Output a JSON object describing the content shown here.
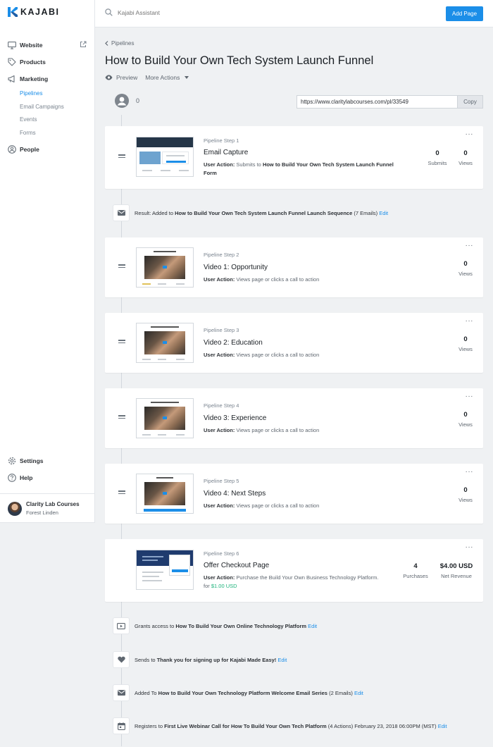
{
  "app": {
    "brand": "KAJABI",
    "accent": "#1b8ee8",
    "success": "#1cb37b"
  },
  "sidebar": {
    "items": [
      {
        "label": "Website",
        "icon": "monitor-icon"
      },
      {
        "label": "Products",
        "icon": "tag-icon"
      },
      {
        "label": "Marketing",
        "icon": "megaphone-icon"
      }
    ],
    "marketing_sub": [
      "Pipelines",
      "Email Campaigns",
      "Events",
      "Forms"
    ],
    "people": "People",
    "settings": "Settings",
    "help": "Help",
    "user": {
      "name": "Clarity Lab Courses",
      "sub": "Forest Linden"
    }
  },
  "topbar": {
    "search_placeholder": "Kajabi Assistant",
    "add_page": "Add Page"
  },
  "page": {
    "breadcrumb": "Pipelines",
    "title": "How to Build Your Own Tech System Launch Funnel",
    "preview": "Preview",
    "more_actions": "More Actions",
    "lead_count": "0",
    "url": "https://www.claritylabcourses.com/pl/33549",
    "copy": "Copy"
  },
  "steps": [
    {
      "label": "Pipeline Step 1",
      "title": "Email Capture",
      "action_label": "User Action:",
      "action_text": "Submits to",
      "action_bold": "How to Build Your Own Tech System Launch Funnel Form",
      "stats": [
        {
          "value": "0",
          "label": "Submits"
        },
        {
          "value": "0",
          "label": "Views"
        }
      ]
    },
    {
      "label": "Pipeline Step 2",
      "title": "Video 1: Opportunity",
      "action_label": "User Action:",
      "action_text": "Views page or clicks a call to action",
      "stats": [
        {
          "value": "0",
          "label": "Views"
        }
      ]
    },
    {
      "label": "Pipeline Step 3",
      "title": "Video 2: Education",
      "action_label": "User Action:",
      "action_text": "Views page or clicks a call to action",
      "stats": [
        {
          "value": "0",
          "label": "Views"
        }
      ]
    },
    {
      "label": "Pipeline Step 4",
      "title": "Video 3: Experience",
      "action_label": "User Action:",
      "action_text": "Views page or clicks a call to action",
      "stats": [
        {
          "value": "0",
          "label": "Views"
        }
      ]
    },
    {
      "label": "Pipeline Step 5",
      "title": "Video 4: Next Steps",
      "action_label": "User Action:",
      "action_text": "Views page or clicks a call to action",
      "stats": [
        {
          "value": "0",
          "label": "Views"
        }
      ]
    },
    {
      "label": "Pipeline Step 6",
      "title": "Offer Checkout Page",
      "action_label": "User Action:",
      "action_text": "Purchase the Build Your Own Business Technology Platform. for",
      "action_price": "$1.00 USD",
      "stats": [
        {
          "value": "4",
          "label": "Purchases"
        },
        {
          "value": "$4.00 USD",
          "label": "Net Revenue"
        }
      ]
    }
  ],
  "result": {
    "prefix": "Result: Added to",
    "bold": "How to Build Your Own Tech System Launch Funnel Launch Sequence",
    "suffix": "(7 Emails)",
    "edit": "Edit"
  },
  "events": [
    {
      "icon": "video-icon",
      "prefix": "Grants access to",
      "bold": "How To Build Your Own Online Technology Platform",
      "suffix": "",
      "edit": "Edit"
    },
    {
      "icon": "heart-icon",
      "prefix": "Sends to",
      "bold": "Thank you for signing up for Kajabi Made Easy!",
      "suffix": "",
      "edit": "Edit"
    },
    {
      "icon": "mail-icon",
      "prefix": "Added To",
      "bold": "How to Build Your Own Technology Platform Welcome Email Series",
      "suffix": "(2 Emails)",
      "edit": "Edit"
    },
    {
      "icon": "calendar-icon",
      "prefix": "Registers to",
      "bold": "First Live Webinar Call for How To Build Your Own Tech Platform",
      "suffix": "(4 Actions) February 23, 2018 06:00PM (MST)",
      "edit": "Edit"
    }
  ]
}
